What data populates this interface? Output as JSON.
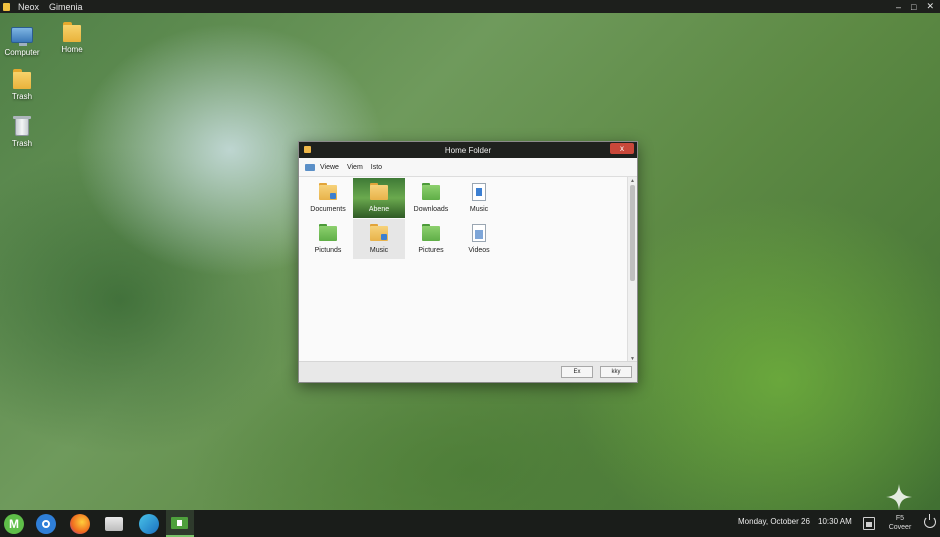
{
  "topbar": {
    "menus": [
      "Neox",
      "Gimenia"
    ],
    "controls": {
      "minimize": "–",
      "maximize": "□",
      "close": "✕"
    }
  },
  "desktop": {
    "icons": [
      {
        "label": "Computer",
        "icon": "computer-icon"
      },
      {
        "label": "Home",
        "icon": "folder-icon"
      },
      {
        "label": "Trash",
        "icon": "folder-icon"
      },
      {
        "label": "Trash",
        "icon": "trash-icon"
      }
    ]
  },
  "window": {
    "title": "Home Folder",
    "close_label": "x",
    "menu": [
      "Viewe",
      "Viem",
      "Isto"
    ],
    "items": [
      {
        "label": "Documents",
        "icon": "folder-yellow-icon",
        "state": "normal"
      },
      {
        "label": "Abene",
        "icon": "folder-yellow-icon",
        "state": "selected"
      },
      {
        "label": "Downloads",
        "icon": "folder-green-icon",
        "state": "normal"
      },
      {
        "label": "Music",
        "icon": "document-icon",
        "state": "normal"
      },
      {
        "label": "Pictunds",
        "icon": "folder-green-icon",
        "state": "normal"
      },
      {
        "label": "Music",
        "icon": "folder-yellow-icon",
        "state": "hovered"
      },
      {
        "label": "Pictures",
        "icon": "folder-green-icon",
        "state": "normal"
      },
      {
        "label": "Videos",
        "icon": "video-document-icon",
        "state": "normal"
      }
    ],
    "footer_buttons": [
      "Ex",
      "kky"
    ]
  },
  "taskbar": {
    "start_label": "M",
    "apps": [
      "blue-circle-app-icon",
      "firefox-icon",
      "files-icon",
      "edge-icon",
      "active-window-icon"
    ],
    "date": "Monday, October 26",
    "time": "10:30 AM",
    "tray_top": "F5",
    "tray_label": "Coveer"
  },
  "colors": {
    "accent": "#79c36a",
    "close": "#c9483a",
    "taskbar": "#1a1d1a"
  }
}
